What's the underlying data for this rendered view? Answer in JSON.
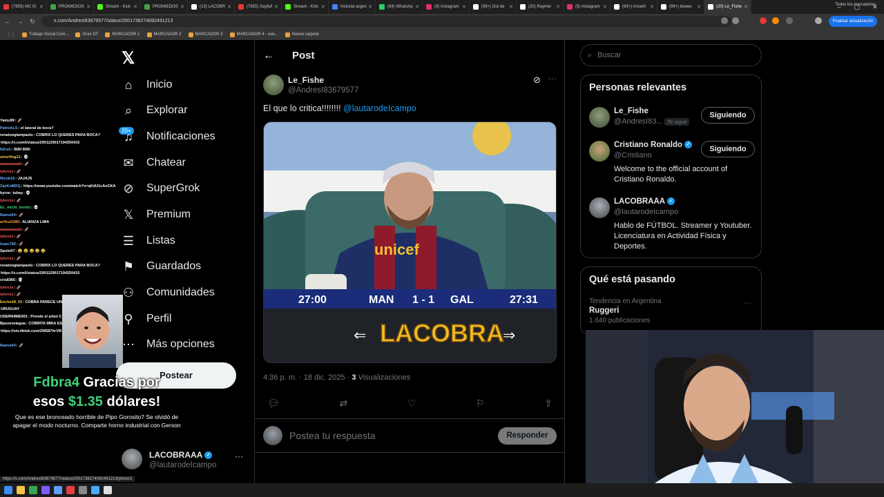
{
  "browser": {
    "tabs": [
      {
        "label": "(7655) MC Ki",
        "color": "#e53935"
      },
      {
        "label": "PROMIEDOS",
        "color": "#43a047"
      },
      {
        "label": "Stream - Kick",
        "color": "#53fc18"
      },
      {
        "label": "PROMIEDOS",
        "color": "#43a047"
      },
      {
        "label": "(13) LACOBR",
        "color": "#ffffff"
      },
      {
        "label": "(7655) Sayfull",
        "color": "#e53935"
      },
      {
        "label": "Stream - Kick",
        "color": "#53fc18"
      },
      {
        "label": "historial argen",
        "color": "#4285f4"
      },
      {
        "label": "(94) WhatsAp",
        "color": "#25d366"
      },
      {
        "label": "(9) Instagram",
        "color": "#e1306c"
      },
      {
        "label": "(99+) Gol de",
        "color": "#ffffff"
      },
      {
        "label": "(20) Raymer",
        "color": "#ffffff"
      },
      {
        "label": "(9) Instagram",
        "color": "#e1306c"
      },
      {
        "label": "(99+) Anseth",
        "color": "#ffffff"
      },
      {
        "label": "(99+) boeee",
        "color": "#ffffff"
      },
      {
        "label": "(20) Le_Fishe",
        "color": "#ffffff",
        "active": true
      }
    ],
    "url": "x.com/AndresI83679577/status/2001738274092491213",
    "update_button": "Finalizar actualización",
    "bookmarks": [
      "Trabajo Social Com...",
      "Gran DT",
      "MARCADOR 1",
      "MARCADOR 2",
      "MARCADOR 3",
      "MARCADOR 4 - ove...",
      "Nueva carpeta"
    ],
    "all_bookmarks": "Todos los marcadores",
    "status_url": "https://x.com/AndresI83679577/status/2001738274092491213/photo/1"
  },
  "nav": {
    "items": [
      {
        "label": "Inicio",
        "icon": "home-icon",
        "glyph": "⌂"
      },
      {
        "label": "Explorar",
        "icon": "search-icon",
        "glyph": "⌕"
      },
      {
        "label": "Notificaciones",
        "icon": "bell-icon",
        "glyph": "♫"
      },
      {
        "label": "Chatear",
        "icon": "mail-icon",
        "glyph": "✉"
      },
      {
        "label": "SuperGrok",
        "icon": "grok-icon",
        "glyph": "⊘"
      },
      {
        "label": "Premium",
        "icon": "x-logo-icon",
        "glyph": "𝕏"
      },
      {
        "label": "Listas",
        "icon": "list-icon",
        "glyph": "☰"
      },
      {
        "label": "Guardados",
        "icon": "bookmark-icon",
        "glyph": "⚑"
      },
      {
        "label": "Comunidades",
        "icon": "people-icon",
        "glyph": "⚇"
      },
      {
        "label": "Perfil",
        "icon": "person-icon",
        "glyph": "⚲"
      },
      {
        "label": "Más opciones",
        "icon": "more-circle-icon",
        "glyph": "⋯"
      }
    ],
    "notif_badge": "20+",
    "post_button": "Postear",
    "account": {
      "name": "LACOBRAAA",
      "handle": "@lautarodeIcampo",
      "more": "···"
    }
  },
  "post": {
    "header_title": "Post",
    "author_name": "Le_Fishe",
    "author_handle": "@AndresI83679577",
    "text": "El que lo critica!!!!!!!! ",
    "mention": "@lautarodeIcampo",
    "timestamp": "4:36 p. m. · 18 dic. 2025 · ",
    "views_count": "3",
    "views_label": " Visualizaciones",
    "reply_placeholder": "Postea tu respuesta",
    "reply_button": "Responder",
    "scoreboard": {
      "left_time": "27:00",
      "home": "MAN",
      "score": "1 - 1",
      "away": "GAL",
      "right_time": "27:31"
    },
    "overlay_text": "LACOBRA"
  },
  "right": {
    "search_placeholder": "Buscar",
    "relevant_title": "Personas relevantes",
    "people": [
      {
        "name": "Le_Fishe",
        "handle": "@AndresI83...",
        "follows_you": "Te sigue",
        "button": "Siguiendo",
        "bio": ""
      },
      {
        "name": "Cristiano Ronaldo",
        "handle": "@Cristiano",
        "button": "Siguiendo",
        "bio": "Welcome to the official account of Cristiano Ronaldo."
      },
      {
        "name": "LACOBRAAA",
        "handle": "@lautarodeIcampo",
        "bio": "Hablo de FÚTBOL. Streamer y Youtuber. Licenciatura en Actividad Física y Deportes."
      }
    ],
    "trending_title": "Qué está pasando",
    "trend": {
      "context": "Tendencia en Argentina",
      "name": "Ruggeri",
      "count": "1.640 publicaciones"
    }
  },
  "chat": {
    "lines": [
      {
        "user": "Yamu99",
        "text": ": 🚀",
        "color": "#ffffff"
      },
      {
        "user": "PatrickLS",
        "text": ": el lateral de boca?",
        "color": "#6fb4ff"
      },
      {
        "user": "renatoogiampaolo",
        "text": ": COBRIX LO QUERES PARA BOCA?",
        "color": "#ffffff"
      },
      {
        "user": "",
        "text": "https://x.com/i/status/2001129017194250415",
        "color": "#ffffff"
      },
      {
        "user": "NZreh",
        "text": ": BIRI BIRI",
        "color": "#6fb4ff"
      },
      {
        "user": "smurfing12",
        "text": ": 💀",
        "color": "#ffd24d"
      },
      {
        "user": "aaaaaaaaab",
        "text": ": 🚀",
        "color": "#ff5a5a"
      },
      {
        "user": "tylercis",
        "text": ": 🚀",
        "color": "#ff5a5a"
      },
      {
        "user": "Nicob16",
        "text": ": JAJAJS",
        "color": "#6fb4ff"
      },
      {
        "user": "ZayKoMDQ",
        "text": ": https://www.youtube.com/watch?v=qKdU1cAoCKA",
        "color": "#6fb4ff"
      },
      {
        "user": "byron_tubay",
        "text": ": 💀",
        "color": "#ffffff"
      },
      {
        "user": "tylercis",
        "text": ": 🚀",
        "color": "#ff5a5a"
      },
      {
        "user": "EL_michi_bonito",
        "text": ": 💀",
        "color": "#3fd07a"
      },
      {
        "user": "Ramsi04",
        "text": ": 🚀",
        "color": "#6fb4ff"
      },
      {
        "user": "arthur0280",
        "text": ": ALIANZA LIMA",
        "color": "#ff9a3c"
      },
      {
        "user": "aaaaaaaaab",
        "text": ": 🚀",
        "color": "#ff5a5a"
      },
      {
        "user": "tylercis",
        "text": ": 🚀",
        "color": "#ff5a5a"
      },
      {
        "user": "Isaac766",
        "text": ": 🚀",
        "color": "#6fb4ff"
      },
      {
        "user": "Spolo07",
        "text": ": 😂 😂 😂 😂 😂",
        "color": "#ffffff"
      },
      {
        "user": "tylercis",
        "text": ": 🚀",
        "color": "#ff5a5a"
      },
      {
        "user": "renatoogiampaolo",
        "text": ": COBRIX LO QUERES PARA BOCA?",
        "color": "#ffffff"
      },
      {
        "user": "",
        "text": "https://x.com/i/status/2001129017194250415",
        "color": "#ffffff"
      },
      {
        "user": "cris8366",
        "text": ": 💀",
        "color": "#ffffff"
      },
      {
        "user": "tylercis",
        "text": ": 🚀",
        "color": "#ff5a5a"
      },
      {
        "user": "tylercis",
        "text": ": 🚀",
        "color": "#ff5a5a"
      },
      {
        "user": "Encho18_03",
        "text": ": COBRA PARECE UN",
        "color": "#ffd24d"
      },
      {
        "user": "",
        "text": "URUGUAY",
        "color": "#ffffff"
      },
      {
        "user": "USERN4ME001",
        "text": ": Prende el arbol C",
        "color": "#ffffff"
      },
      {
        "user": "Bpezenelagua",
        "text": ": COBRITA MIRA ES",
        "color": "#ffffff"
      },
      {
        "user": "",
        "text": "https://vm.tiktok.com/ZMS87hrV9/",
        "color": "#ffffff"
      },
      {
        "user": "",
        "text": "",
        "color": "#ffffff"
      },
      {
        "user": "Ramsi04",
        "text": ": 🚀",
        "color": "#6fb4ff"
      }
    ],
    "donation": {
      "user": "Fdbra4",
      "line1": " Gracias por",
      "line2a": "esos ",
      "amount": "$1.35",
      "line2b": " dólares!",
      "message": "Que es ese bronceado horrible de Pipo Gorosito? Se olvidó de apagar el modo nocturno. Comparte horno industrial con Gerson"
    }
  }
}
